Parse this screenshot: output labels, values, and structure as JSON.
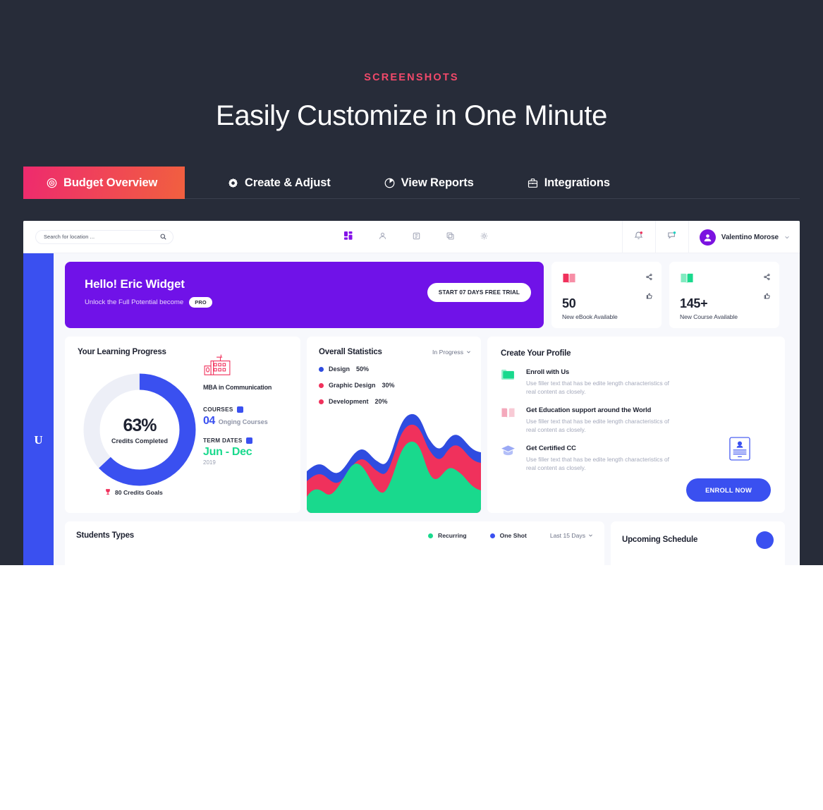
{
  "hero": {
    "eyebrow": "SCREENSHOTS",
    "headline": "Easily Customize in One Minute",
    "bg_color": "#272c39",
    "accent_color": "#f2496a"
  },
  "tabs": [
    {
      "label": "Budget Overview",
      "icon": "target-icon",
      "active": true
    },
    {
      "label": "Create & Adjust",
      "icon": "gear-icon",
      "active": false
    },
    {
      "label": "View Reports",
      "icon": "pie-chart-icon",
      "active": false
    },
    {
      "label": "Integrations",
      "icon": "briefcase-icon",
      "active": false
    }
  ],
  "tab_gradient": {
    "from": "#ee2a6e",
    "to": "#f1603f"
  },
  "dashboard": {
    "topbar": {
      "search_placeholder": "Search for location ...",
      "nav_icons": [
        "dashboard-grid-icon",
        "user-icon",
        "book-icon",
        "copy-icon",
        "settings-gear-icon"
      ],
      "notification_icon": "bell-icon",
      "messages_icon": "message-icon",
      "user_name": "Valentino Morose"
    },
    "sidebar": {
      "logo": "U",
      "color": "#3a50f0"
    },
    "banner": {
      "greeting": "Hello! Eric Widget",
      "subtitle": "Unlock the Full Potential become",
      "badge": "PRO",
      "cta": "START 07 DAYS FREE TRIAL",
      "color": "#7012e8"
    },
    "stat_cards": [
      {
        "icon": "book-open-icon",
        "icon_color": "#f0315c",
        "value": "50",
        "label": "New eBook Available"
      },
      {
        "icon": "book-open-icon",
        "icon_color": "#19d98d",
        "value": "145+",
        "label": "New Course Available"
      }
    ],
    "learning_progress": {
      "title": "Your Learning Progress",
      "percent": "63%",
      "percent_value": 63,
      "caption": "Credits Completed",
      "goal": "80 Credits Goals",
      "goal_icon": "trophy-icon",
      "degree": "MBA in Communication",
      "degree_icon": "university-icon",
      "courses_label": "COURSES",
      "courses_value": "04",
      "courses_sub": "Onging Courses",
      "term_label": "TERM DATES",
      "term_value": "Jun - Dec",
      "term_year": "2019",
      "arc_color": "#3a50f0",
      "track_color": "#edeff7"
    },
    "overall_statistics": {
      "title": "Overall Statistics",
      "dropdown": "In Progress",
      "legend": [
        {
          "name": "Design",
          "value": "50%",
          "color": "#2f4ce0"
        },
        {
          "name": "Graphic Design",
          "value": "30%",
          "color": "#f0315c"
        },
        {
          "name": "Development",
          "value": "20%",
          "color": "#f0315c"
        }
      ]
    },
    "create_profile": {
      "title": "Create Your Profile",
      "features": [
        {
          "icon": "folder-icon",
          "icon_color": "#19d98d",
          "title": "Enroll with Us",
          "desc": "Use filler text that has be edite length characteristics of real content as closely."
        },
        {
          "icon": "book-open-icon",
          "icon_color": "#f4a9bc",
          "title": "Get Education support around the World",
          "desc": "Use filler text that has be edite length characteristics of real content as closely."
        },
        {
          "icon": "graduation-cap-icon",
          "icon_color": "#9aa9f5",
          "title": "Get Certified CC",
          "desc": "Use filler text that has be edite length characteristics of real content as closely."
        }
      ],
      "badge_icon": "id-card-icon",
      "cta": "ENROLL NOW"
    },
    "students_types": {
      "title": "Students Types",
      "legend": [
        {
          "name": "Recurring",
          "color": "#19d98d"
        },
        {
          "name": "One Shot",
          "color": "#3a50f0"
        }
      ],
      "dropdown": "Last 15 Days"
    },
    "upcoming_schedule": {
      "title": "Upcoming Schedule"
    }
  },
  "chart_data": [
    {
      "type": "pie",
      "title": "Your Learning Progress",
      "categories": [
        "Credits Completed",
        "Remaining"
      ],
      "values": [
        63,
        37
      ],
      "colors": [
        "#3a50f0",
        "#edeff7"
      ],
      "annotations": [
        "63%",
        "Credits Completed",
        "80 Credits Goals"
      ]
    },
    {
      "type": "area",
      "title": "Overall Statistics",
      "stacked": true,
      "legend_position": "top-left",
      "grid": false,
      "xlabel": "",
      "ylabel": "",
      "ylim": [
        0,
        100
      ],
      "x": [
        0,
        1,
        2,
        3,
        4,
        5,
        6,
        7,
        8,
        9,
        10,
        11,
        12,
        13,
        14,
        15
      ],
      "series": [
        {
          "name": "Development",
          "value_label": "20%",
          "color": "#19d98d",
          "values": [
            25,
            38,
            30,
            44,
            54,
            40,
            33,
            45,
            68,
            86,
            70,
            58,
            50,
            58,
            70,
            46
          ]
        },
        {
          "name": "Graphic Design",
          "value_label": "30%",
          "color": "#f0315c",
          "values": [
            14,
            15,
            14,
            18,
            15,
            15,
            14,
            17,
            16,
            15,
            15,
            16,
            15,
            15,
            15,
            15
          ]
        },
        {
          "name": "Design",
          "value_label": "50%",
          "color": "#2f4ce0",
          "values": [
            9,
            9,
            9,
            10,
            9,
            9,
            9,
            10,
            10,
            9,
            9,
            10,
            11,
            10,
            9,
            9
          ]
        }
      ]
    }
  ]
}
